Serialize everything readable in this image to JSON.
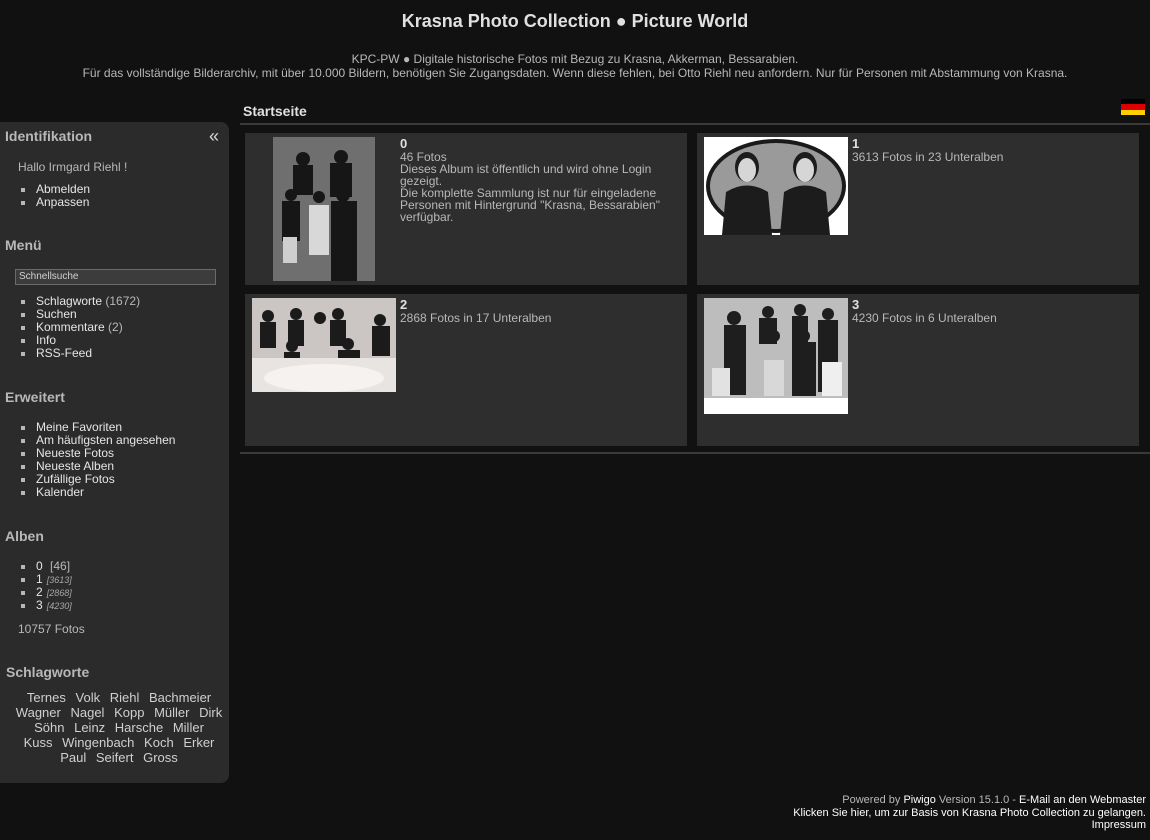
{
  "header": {
    "title": "Krasna Photo Collection ● Picture World",
    "desc_line1": "KPC-PW ● Digitale historische Fotos mit Bezug zu Krasna, Akkerman, Bessarabien.",
    "desc_line2": "Für das vollständige Bilderarchiv, mit über 10.000 Bildern, benötigen Sie Zugangsdaten. Wenn diese fehlen, bei Otto Riehl neu anfordern. Nur für Personen mit Abstammung von Krasna."
  },
  "sidebar": {
    "collapse_icon": "«",
    "ident": {
      "title": "Identifikation",
      "greeting": "Hallo Irmgard Riehl !",
      "links": [
        "Abmelden",
        "Anpassen"
      ]
    },
    "menu": {
      "title": "Menü",
      "search_placeholder": "Schnellsuche",
      "items": [
        {
          "label": "Schlagworte",
          "count": "(1672)"
        },
        {
          "label": "Suchen",
          "count": ""
        },
        {
          "label": "Kommentare",
          "count": "(2)"
        },
        {
          "label": "Info",
          "count": ""
        },
        {
          "label": "RSS-Feed",
          "count": ""
        }
      ]
    },
    "advanced": {
      "title": "Erweitert",
      "items": [
        "Meine Favoriten",
        "Am häufigsten angesehen",
        "Neueste Fotos",
        "Neueste Alben",
        "Zufällige Fotos",
        "Kalender"
      ]
    },
    "albums": {
      "title": "Alben",
      "items": [
        {
          "label": "0",
          "count": "[46]"
        },
        {
          "label": "1",
          "count": "[3613]"
        },
        {
          "label": "2",
          "count": "[2868]"
        },
        {
          "label": "3",
          "count": "[4230]"
        }
      ],
      "total": "10757 Fotos"
    },
    "tags": {
      "title": "Schlagworte",
      "items": [
        "Ternes",
        "Volk",
        "Riehl",
        "Bachmeier",
        "Wagner",
        "Nagel",
        "Kopp",
        "Müller",
        "Dirk",
        "Söhn",
        "Leinz",
        "Harsche",
        "Miller",
        "Kuss",
        "Wingenbach",
        "Koch",
        "Erker",
        "Paul",
        "Seifert",
        "Gross"
      ]
    }
  },
  "content": {
    "title": "Startseite",
    "flag_colors": [
      "#000000",
      "#dd0000",
      "#ffce00"
    ],
    "albums": [
      {
        "name": "0",
        "line1": "46 Fotos",
        "line2": "Dieses Album ist öffentlich und wird ohne Login gezeigt.",
        "line3": "Die komplette Sammlung ist nur für eingeladene",
        "line4": "Personen mit Hintergrund \"Krasna, Bessarabien\"",
        "line5": "verfügbar."
      },
      {
        "name": "1",
        "line1": "3613 Fotos in 23 Unteralben"
      },
      {
        "name": "2",
        "line1": "2868 Fotos in 17 Unteralben"
      },
      {
        "name": "3",
        "line1": "4230 Fotos in 6 Unteralben"
      }
    ]
  },
  "footer": {
    "powered_prefix": "Powered by",
    "piwigo": "Piwigo",
    "version": "Version 15.1.0 -",
    "email": "E-Mail an den Webmaster",
    "basis_link": "Klicken Sie hier, um zur Basis von Krasna Photo Collection zu gelangen.",
    "impressum": "Impressum"
  }
}
